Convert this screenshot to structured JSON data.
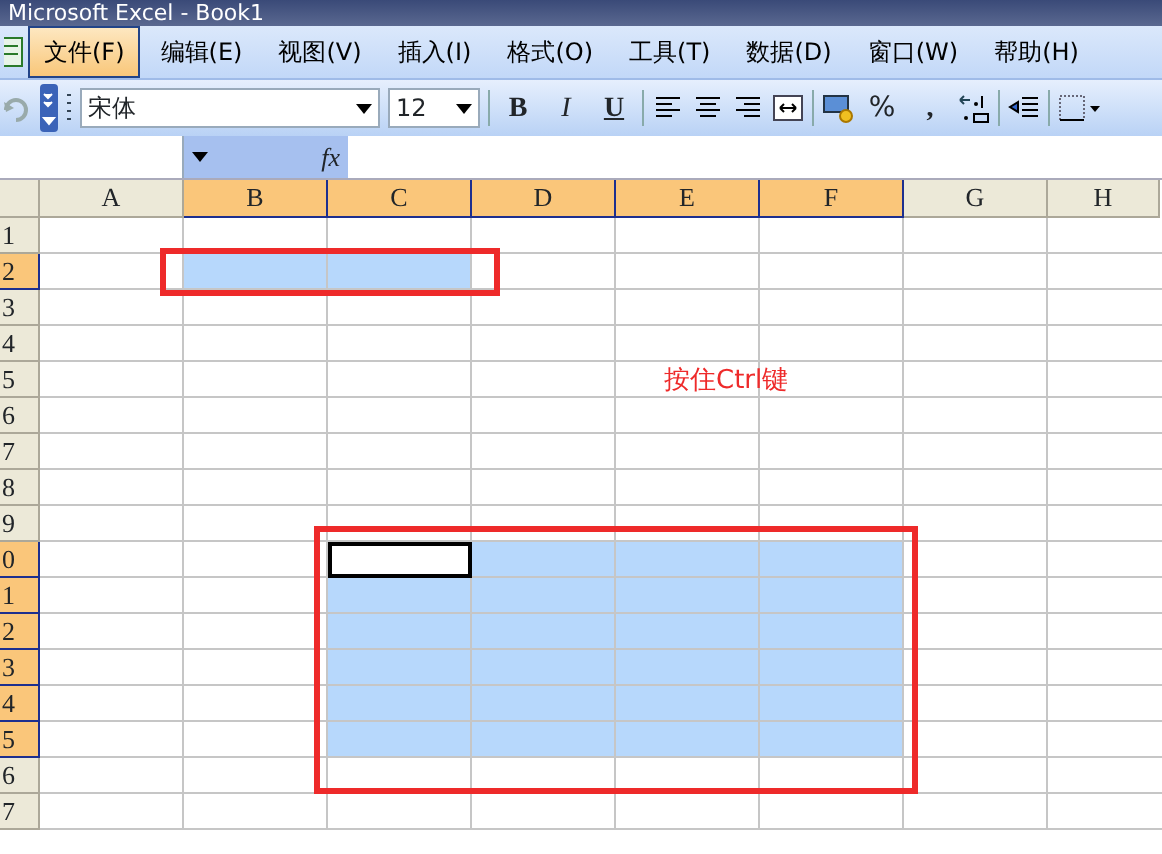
{
  "window": {
    "title": "Microsoft Excel - Book1"
  },
  "menu": [
    {
      "label": "文件(F)",
      "selected": true
    },
    {
      "label": "编辑(E)",
      "selected": false
    },
    {
      "label": "视图(V)",
      "selected": false
    },
    {
      "label": "插入(I)",
      "selected": false
    },
    {
      "label": "格式(O)",
      "selected": false
    },
    {
      "label": "工具(T)",
      "selected": false
    },
    {
      "label": "数据(D)",
      "selected": false
    },
    {
      "label": "窗口(W)",
      "selected": false
    },
    {
      "label": "帮助(H)",
      "selected": false
    }
  ],
  "toolbar": {
    "font": "宋体",
    "size": "12",
    "items": [
      {
        "kind": "separator"
      },
      {
        "kind": "bold",
        "label": "B"
      },
      {
        "kind": "italic",
        "label": "I"
      },
      {
        "kind": "underline",
        "label": "U"
      },
      {
        "kind": "separator"
      },
      {
        "kind": "alignleft"
      },
      {
        "kind": "aligncenter"
      },
      {
        "kind": "alignright"
      },
      {
        "kind": "merge"
      },
      {
        "kind": "separator"
      },
      {
        "kind": "currency"
      },
      {
        "kind": "percent",
        "label": "%"
      },
      {
        "kind": "comma",
        "label": ","
      },
      {
        "kind": "decimal"
      },
      {
        "kind": "separator"
      },
      {
        "kind": "indent"
      },
      {
        "kind": "separator"
      },
      {
        "kind": "borders"
      }
    ]
  },
  "formula_bar": {
    "function_label": "fx"
  },
  "sheet": {
    "selection_frames": true,
    "columns": [
      {
        "label": "A",
        "selected": false
      },
      {
        "label": "B",
        "selected": true
      },
      {
        "label": "C",
        "selected": true
      },
      {
        "label": "D",
        "selected": true
      },
      {
        "label": "E",
        "selected": true
      },
      {
        "label": "F",
        "selected": true
      },
      {
        "label": "G",
        "selected": false
      },
      {
        "label": "H",
        "selected": false
      }
    ],
    "rows": [
      {
        "label": "1",
        "selected": false,
        "cells": [
          {
            "selected": false,
            "active": false
          },
          {
            "selected": false,
            "active": false
          },
          {
            "selected": false,
            "active": false
          },
          {
            "selected": false,
            "active": false
          },
          {
            "selected": false,
            "active": false
          },
          {
            "selected": false,
            "active": false
          },
          {
            "selected": false,
            "active": false
          },
          {
            "selected": false,
            "active": false
          }
        ]
      },
      {
        "label": "2",
        "selected": true,
        "cells": [
          {
            "selected": false,
            "active": false
          },
          {
            "selected": true,
            "active": false
          },
          {
            "selected": true,
            "active": false
          },
          {
            "selected": false,
            "active": false
          },
          {
            "selected": false,
            "active": false
          },
          {
            "selected": false,
            "active": false
          },
          {
            "selected": false,
            "active": false
          },
          {
            "selected": false,
            "active": false
          }
        ]
      },
      {
        "label": "3",
        "selected": false,
        "cells": [
          {
            "selected": false,
            "active": false
          },
          {
            "selected": false,
            "active": false
          },
          {
            "selected": false,
            "active": false
          },
          {
            "selected": false,
            "active": false
          },
          {
            "selected": false,
            "active": false
          },
          {
            "selected": false,
            "active": false
          },
          {
            "selected": false,
            "active": false
          },
          {
            "selected": false,
            "active": false
          }
        ]
      },
      {
        "label": "4",
        "selected": false,
        "cells": [
          {
            "selected": false,
            "active": false
          },
          {
            "selected": false,
            "active": false
          },
          {
            "selected": false,
            "active": false
          },
          {
            "selected": false,
            "active": false
          },
          {
            "selected": false,
            "active": false
          },
          {
            "selected": false,
            "active": false
          },
          {
            "selected": false,
            "active": false
          },
          {
            "selected": false,
            "active": false
          }
        ]
      },
      {
        "label": "5",
        "selected": false,
        "cells": [
          {
            "selected": false,
            "active": false
          },
          {
            "selected": false,
            "active": false
          },
          {
            "selected": false,
            "active": false
          },
          {
            "selected": false,
            "active": false
          },
          {
            "selected": false,
            "active": false,
            "note": "按住Ctrl键"
          },
          {
            "selected": false,
            "active": false
          },
          {
            "selected": false,
            "active": false
          },
          {
            "selected": false,
            "active": false
          }
        ]
      },
      {
        "label": "6",
        "selected": false,
        "cells": [
          {
            "selected": false,
            "active": false
          },
          {
            "selected": false,
            "active": false
          },
          {
            "selected": false,
            "active": false
          },
          {
            "selected": false,
            "active": false
          },
          {
            "selected": false,
            "active": false
          },
          {
            "selected": false,
            "active": false
          },
          {
            "selected": false,
            "active": false
          },
          {
            "selected": false,
            "active": false
          }
        ]
      },
      {
        "label": "7",
        "selected": false,
        "cells": [
          {
            "selected": false,
            "active": false
          },
          {
            "selected": false,
            "active": false
          },
          {
            "selected": false,
            "active": false
          },
          {
            "selected": false,
            "active": false
          },
          {
            "selected": false,
            "active": false
          },
          {
            "selected": false,
            "active": false
          },
          {
            "selected": false,
            "active": false
          },
          {
            "selected": false,
            "active": false
          }
        ]
      },
      {
        "label": "8",
        "selected": false,
        "cells": [
          {
            "selected": false,
            "active": false
          },
          {
            "selected": false,
            "active": false
          },
          {
            "selected": false,
            "active": false
          },
          {
            "selected": false,
            "active": false
          },
          {
            "selected": false,
            "active": false
          },
          {
            "selected": false,
            "active": false
          },
          {
            "selected": false,
            "active": false
          },
          {
            "selected": false,
            "active": false
          }
        ]
      },
      {
        "label": "9",
        "selected": false,
        "cells": [
          {
            "selected": false,
            "active": false
          },
          {
            "selected": false,
            "active": false
          },
          {
            "selected": false,
            "active": false
          },
          {
            "selected": false,
            "active": false
          },
          {
            "selected": false,
            "active": false
          },
          {
            "selected": false,
            "active": false
          },
          {
            "selected": false,
            "active": false
          },
          {
            "selected": false,
            "active": false
          }
        ]
      },
      {
        "label": "0",
        "selected": true,
        "cells": [
          {
            "selected": false,
            "active": false
          },
          {
            "selected": false,
            "active": false
          },
          {
            "selected": true,
            "active": true
          },
          {
            "selected": true,
            "active": false
          },
          {
            "selected": true,
            "active": false
          },
          {
            "selected": true,
            "active": false
          },
          {
            "selected": false,
            "active": false
          },
          {
            "selected": false,
            "active": false
          }
        ]
      },
      {
        "label": "1",
        "selected": true,
        "cells": [
          {
            "selected": false,
            "active": false
          },
          {
            "selected": false,
            "active": false
          },
          {
            "selected": true,
            "active": false
          },
          {
            "selected": true,
            "active": false
          },
          {
            "selected": true,
            "active": false
          },
          {
            "selected": true,
            "active": false
          },
          {
            "selected": false,
            "active": false
          },
          {
            "selected": false,
            "active": false
          }
        ]
      },
      {
        "label": "2",
        "selected": true,
        "cells": [
          {
            "selected": false,
            "active": false
          },
          {
            "selected": false,
            "active": false
          },
          {
            "selected": true,
            "active": false
          },
          {
            "selected": true,
            "active": false
          },
          {
            "selected": true,
            "active": false
          },
          {
            "selected": true,
            "active": false
          },
          {
            "selected": false,
            "active": false
          },
          {
            "selected": false,
            "active": false
          }
        ]
      },
      {
        "label": "3",
        "selected": true,
        "cells": [
          {
            "selected": false,
            "active": false
          },
          {
            "selected": false,
            "active": false
          },
          {
            "selected": true,
            "active": false
          },
          {
            "selected": true,
            "active": false
          },
          {
            "selected": true,
            "active": false
          },
          {
            "selected": true,
            "active": false
          },
          {
            "selected": false,
            "active": false
          },
          {
            "selected": false,
            "active": false
          }
        ]
      },
      {
        "label": "4",
        "selected": true,
        "cells": [
          {
            "selected": false,
            "active": false
          },
          {
            "selected": false,
            "active": false
          },
          {
            "selected": true,
            "active": false
          },
          {
            "selected": true,
            "active": false
          },
          {
            "selected": true,
            "active": false
          },
          {
            "selected": true,
            "active": false
          },
          {
            "selected": false,
            "active": false
          },
          {
            "selected": false,
            "active": false
          }
        ]
      },
      {
        "label": "5",
        "selected": true,
        "cells": [
          {
            "selected": false,
            "active": false
          },
          {
            "selected": false,
            "active": false
          },
          {
            "selected": true,
            "active": false
          },
          {
            "selected": true,
            "active": false
          },
          {
            "selected": true,
            "active": false
          },
          {
            "selected": true,
            "active": false
          },
          {
            "selected": false,
            "active": false
          },
          {
            "selected": false,
            "active": false
          }
        ]
      },
      {
        "label": "6",
        "selected": false,
        "cells": [
          {
            "selected": false,
            "active": false
          },
          {
            "selected": false,
            "active": false
          },
          {
            "selected": false,
            "active": false
          },
          {
            "selected": false,
            "active": false
          },
          {
            "selected": false,
            "active": false
          },
          {
            "selected": false,
            "active": false
          },
          {
            "selected": false,
            "active": false
          },
          {
            "selected": false,
            "active": false
          }
        ]
      },
      {
        "label": "7",
        "selected": false,
        "cells": [
          {
            "selected": false,
            "active": false
          },
          {
            "selected": false,
            "active": false
          },
          {
            "selected": false,
            "active": false
          },
          {
            "selected": false,
            "active": false
          },
          {
            "selected": false,
            "active": false
          },
          {
            "selected": false,
            "active": false
          },
          {
            "selected": false,
            "active": false
          },
          {
            "selected": false,
            "active": false
          }
        ]
      }
    ]
  }
}
